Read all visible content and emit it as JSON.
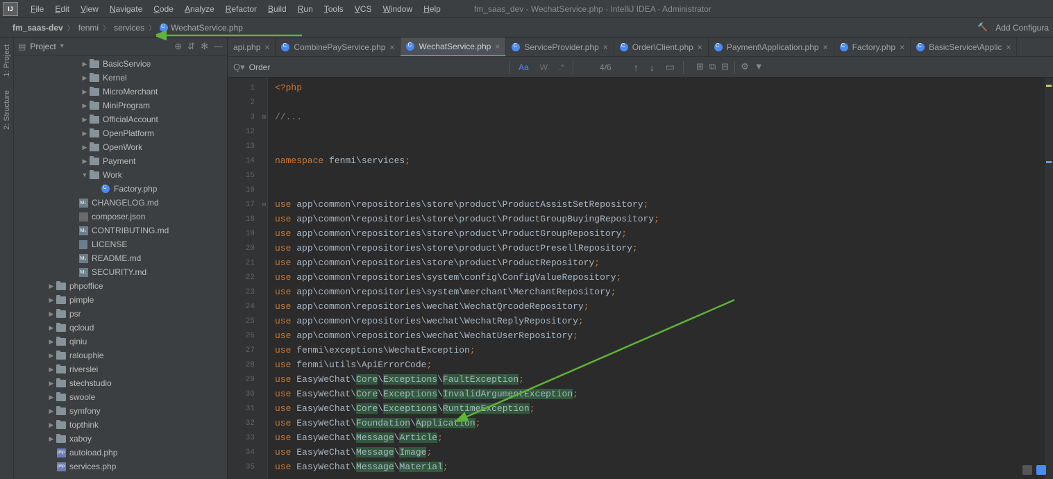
{
  "title": "fm_saas_dev - WechatService.php - IntelliJ IDEA - Administrator",
  "menu": [
    "File",
    "Edit",
    "View",
    "Navigate",
    "Code",
    "Analyze",
    "Refactor",
    "Build",
    "Run",
    "Tools",
    "VCS",
    "Window",
    "Help"
  ],
  "breadcrumb": {
    "root": "fm_saas-dev",
    "parts": [
      "fenmi",
      "services"
    ],
    "file": "WechatService.php"
  },
  "add_config": "Add Configura",
  "rails": [
    "1: Project",
    "2: Structure"
  ],
  "project": {
    "label": "Project",
    "tree": [
      {
        "indent": 6,
        "tw": "▶",
        "icon": "folder",
        "label": "BasicService"
      },
      {
        "indent": 6,
        "tw": "▶",
        "icon": "folder",
        "label": "Kernel"
      },
      {
        "indent": 6,
        "tw": "▶",
        "icon": "folder",
        "label": "MicroMerchant"
      },
      {
        "indent": 6,
        "tw": "▶",
        "icon": "folder",
        "label": "MiniProgram"
      },
      {
        "indent": 6,
        "tw": "▶",
        "icon": "folder",
        "label": "OfficialAccount"
      },
      {
        "indent": 6,
        "tw": "▶",
        "icon": "folder",
        "label": "OpenPlatform"
      },
      {
        "indent": 6,
        "tw": "▶",
        "icon": "folder",
        "label": "OpenWork"
      },
      {
        "indent": 6,
        "tw": "▶",
        "icon": "folder",
        "label": "Payment"
      },
      {
        "indent": 6,
        "tw": "▼",
        "icon": "folder",
        "label": "Work"
      },
      {
        "indent": 7,
        "tw": "",
        "icon": "cfile",
        "label": "Factory.php"
      },
      {
        "indent": 5,
        "tw": "",
        "icon": "md",
        "label": "CHANGELOG.md"
      },
      {
        "indent": 5,
        "tw": "",
        "icon": "json",
        "label": "composer.json"
      },
      {
        "indent": 5,
        "tw": "",
        "icon": "md",
        "label": "CONTRIBUTING.md"
      },
      {
        "indent": 5,
        "tw": "",
        "icon": "txt",
        "label": "LICENSE"
      },
      {
        "indent": 5,
        "tw": "",
        "icon": "md",
        "label": "README.md"
      },
      {
        "indent": 5,
        "tw": "",
        "icon": "md",
        "label": "SECURITY.md"
      },
      {
        "indent": 3,
        "tw": "▶",
        "icon": "folder",
        "label": "phpoffice"
      },
      {
        "indent": 3,
        "tw": "▶",
        "icon": "folder",
        "label": "pimple"
      },
      {
        "indent": 3,
        "tw": "▶",
        "icon": "folder",
        "label": "psr"
      },
      {
        "indent": 3,
        "tw": "▶",
        "icon": "folder",
        "label": "qcloud"
      },
      {
        "indent": 3,
        "tw": "▶",
        "icon": "folder",
        "label": "qiniu"
      },
      {
        "indent": 3,
        "tw": "▶",
        "icon": "folder",
        "label": "ralouphie"
      },
      {
        "indent": 3,
        "tw": "▶",
        "icon": "folder",
        "label": "riverslei"
      },
      {
        "indent": 3,
        "tw": "▶",
        "icon": "folder",
        "label": "stechstudio"
      },
      {
        "indent": 3,
        "tw": "▶",
        "icon": "folder",
        "label": "swoole"
      },
      {
        "indent": 3,
        "tw": "▶",
        "icon": "folder",
        "label": "symfony"
      },
      {
        "indent": 3,
        "tw": "▶",
        "icon": "folder",
        "label": "topthink"
      },
      {
        "indent": 3,
        "tw": "▶",
        "icon": "folder",
        "label": "xaboy"
      },
      {
        "indent": 3,
        "tw": "",
        "icon": "php",
        "label": "autoload.php"
      },
      {
        "indent": 3,
        "tw": "",
        "icon": "php",
        "label": "services.php"
      }
    ]
  },
  "tabs": [
    {
      "label": "api.php",
      "first": true
    },
    {
      "label": "CombinePayService.php"
    },
    {
      "label": "WechatService.php",
      "active": true
    },
    {
      "label": "ServiceProvider.php"
    },
    {
      "label": "Order\\Client.php"
    },
    {
      "label": "Payment\\Application.php"
    },
    {
      "label": "Factory.php"
    },
    {
      "label": "BasicService\\Applic"
    }
  ],
  "find": {
    "value": "Order",
    "count": "4/6"
  },
  "code": {
    "lines": [
      {
        "n": 1,
        "html": "<span class='php-open'>&lt;?php</span>"
      },
      {
        "n": 2,
        "html": ""
      },
      {
        "n": 3,
        "html": "<span class='comment'>//...</span>",
        "fold": "⊞"
      },
      {
        "n": 12,
        "html": ""
      },
      {
        "n": 13,
        "html": ""
      },
      {
        "n": 14,
        "html": "<span class='kw'>namespace </span><span class='ns'>fenmi\\services</span><span class='semi'>;</span>"
      },
      {
        "n": 15,
        "html": ""
      },
      {
        "n": 16,
        "html": ""
      },
      {
        "n": 17,
        "html": "<span class='kw'>use </span><span class='pkg'>app\\common\\repositories\\store\\product\\ProductAssistSetRepository</span><span class='semi'>;</span>",
        "fold": "⊟"
      },
      {
        "n": 18,
        "html": "<span class='kw'>use </span><span class='pkg'>app\\common\\repositories\\store\\product\\ProductGroupBuyingRepository</span><span class='semi'>;</span>"
      },
      {
        "n": 19,
        "html": "<span class='kw'>use </span><span class='pkg'>app\\common\\repositories\\store\\product\\ProductGroupRepository</span><span class='semi'>;</span>"
      },
      {
        "n": 20,
        "html": "<span class='kw'>use </span><span class='pkg'>app\\common\\repositories\\store\\product\\ProductPresellRepository</span><span class='semi'>;</span>"
      },
      {
        "n": 21,
        "html": "<span class='kw'>use </span><span class='pkg'>app\\common\\repositories\\store\\product\\ProductRepository</span><span class='semi'>;</span>"
      },
      {
        "n": 22,
        "html": "<span class='kw'>use </span><span class='pkg'>app\\common\\repositories\\system\\config\\ConfigValueRepository</span><span class='semi'>;</span>"
      },
      {
        "n": 23,
        "html": "<span class='kw'>use </span><span class='pkg'>app\\common\\repositories\\system\\merchant\\MerchantRepository</span><span class='semi'>;</span>"
      },
      {
        "n": 24,
        "html": "<span class='kw'>use </span><span class='pkg'>app\\common\\repositories\\wechat\\WechatQrcodeRepository</span><span class='semi'>;</span>"
      },
      {
        "n": 25,
        "html": "<span class='kw'>use </span><span class='pkg'>app\\common\\repositories\\wechat\\WechatReplyRepository</span><span class='semi'>;</span>"
      },
      {
        "n": 26,
        "html": "<span class='kw'>use </span><span class='pkg'>app\\common\\repositories\\wechat\\WechatUserRepository</span><span class='semi'>;</span>"
      },
      {
        "n": 27,
        "html": "<span class='kw'>use </span><span class='pkg'>fenmi\\exceptions\\WechatException</span><span class='semi'>;</span>"
      },
      {
        "n": 28,
        "html": "<span class='kw'>use </span><span class='pkg'>fenmi\\utils\\ApiErrorCode</span><span class='semi'>;</span>"
      },
      {
        "n": 29,
        "html": "<span class='kw'>use </span><span class='pkg'>EasyWeChat\\<span class='hl'>Core</span>\\<span class='hl'>Exceptions</span>\\<span class='hl'>FaultException</span></span><span class='semi'>;</span>"
      },
      {
        "n": 30,
        "html": "<span class='kw'>use </span><span class='pkg'>EasyWeChat\\<span class='hl'>Core</span>\\<span class='hl'>Exceptions</span>\\<span class='hl'>InvalidArgumentException</span></span><span class='semi'>;</span>"
      },
      {
        "n": 31,
        "html": "<span class='kw'>use </span><span class='pkg'>EasyWeChat\\<span class='hl'>Core</span>\\<span class='hl'>Exceptions</span>\\<span class='hl'>RuntimeException</span></span><span class='semi'>;</span>"
      },
      {
        "n": 32,
        "html": "<span class='kw'>use </span><span class='pkg'>EasyWeChat\\<span class='hl'>Foundation</span>\\<span class='hl'>Application</span></span><span class='semi'>;</span>"
      },
      {
        "n": 33,
        "html": "<span class='kw'>use </span><span class='pkg'>EasyWeChat\\<span class='hl'>Message</span>\\<span class='hl'>Article</span></span><span class='semi'>;</span>"
      },
      {
        "n": 34,
        "html": "<span class='kw'>use </span><span class='pkg'>EasyWeChat\\<span class='hl'>Message</span>\\<span class='hl'>Image</span></span><span class='semi'>;</span>"
      },
      {
        "n": 35,
        "html": "<span class='kw'>use </span><span class='pkg'>EasyWeChat\\<span class='hl'>Message</span>\\<span class='hl'>Material</span></span><span class='semi'>;</span>"
      }
    ]
  }
}
